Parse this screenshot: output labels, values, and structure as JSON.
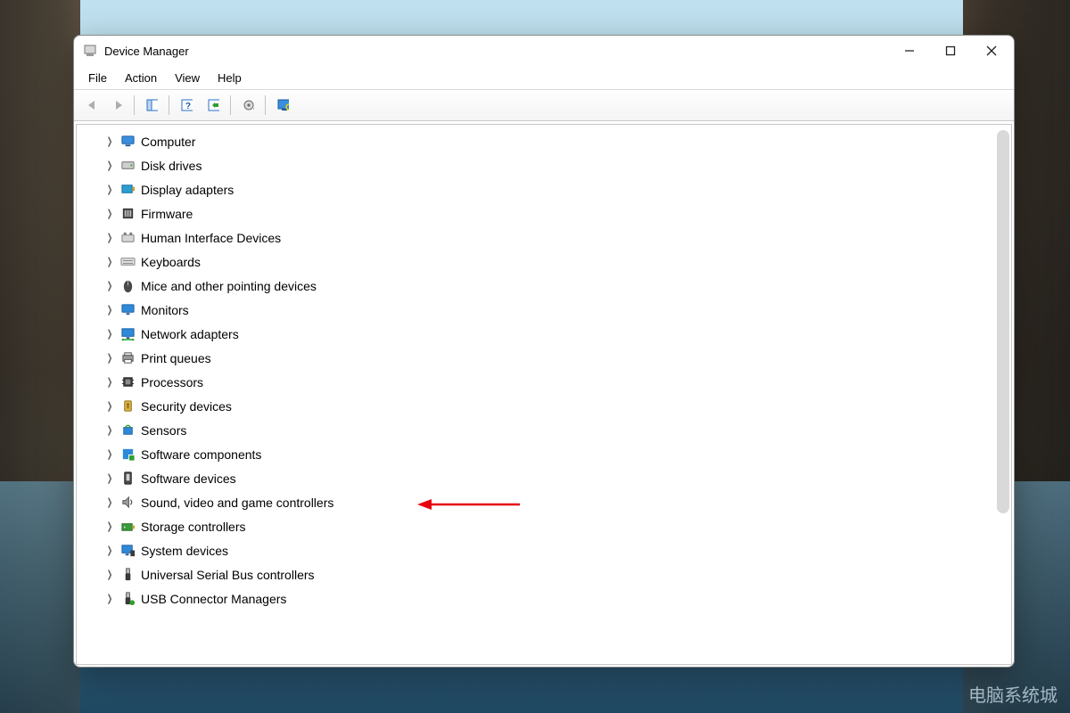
{
  "window": {
    "title": "Device Manager"
  },
  "menubar": {
    "items": [
      "File",
      "Action",
      "View",
      "Help"
    ]
  },
  "toolbar": {
    "buttons": [
      {
        "name": "back-button",
        "icon": "arrow-left",
        "disabled": true
      },
      {
        "name": "forward-button",
        "icon": "arrow-right",
        "disabled": true
      },
      {
        "name": "show-hidden-button",
        "icon": "panel"
      },
      {
        "name": "help-button",
        "icon": "help-panel"
      },
      {
        "name": "action-button",
        "icon": "action-panel"
      },
      {
        "name": "update-driver-button",
        "icon": "gear-update"
      },
      {
        "name": "scan-hardware-button",
        "icon": "monitor-search"
      }
    ]
  },
  "tree": {
    "items": [
      {
        "label": "Computer",
        "icon": "computer"
      },
      {
        "label": "Disk drives",
        "icon": "disk"
      },
      {
        "label": "Display adapters",
        "icon": "display-adapter"
      },
      {
        "label": "Firmware",
        "icon": "firmware"
      },
      {
        "label": "Human Interface Devices",
        "icon": "hid"
      },
      {
        "label": "Keyboards",
        "icon": "keyboard"
      },
      {
        "label": "Mice and other pointing devices",
        "icon": "mouse"
      },
      {
        "label": "Monitors",
        "icon": "monitor"
      },
      {
        "label": "Network adapters",
        "icon": "network"
      },
      {
        "label": "Print queues",
        "icon": "printer"
      },
      {
        "label": "Processors",
        "icon": "processor"
      },
      {
        "label": "Security devices",
        "icon": "security"
      },
      {
        "label": "Sensors",
        "icon": "sensor"
      },
      {
        "label": "Software components",
        "icon": "software-component"
      },
      {
        "label": "Software devices",
        "icon": "software-device"
      },
      {
        "label": "Sound, video and game controllers",
        "icon": "sound",
        "highlight": true
      },
      {
        "label": "Storage controllers",
        "icon": "storage"
      },
      {
        "label": "System devices",
        "icon": "system"
      },
      {
        "label": "Universal Serial Bus controllers",
        "icon": "usb"
      },
      {
        "label": "USB Connector Managers",
        "icon": "usb-connector"
      }
    ]
  },
  "annotation": {
    "arrow_color": "#e7040f"
  },
  "watermark": {
    "line1": "电脑系统城",
    "line2": ""
  }
}
